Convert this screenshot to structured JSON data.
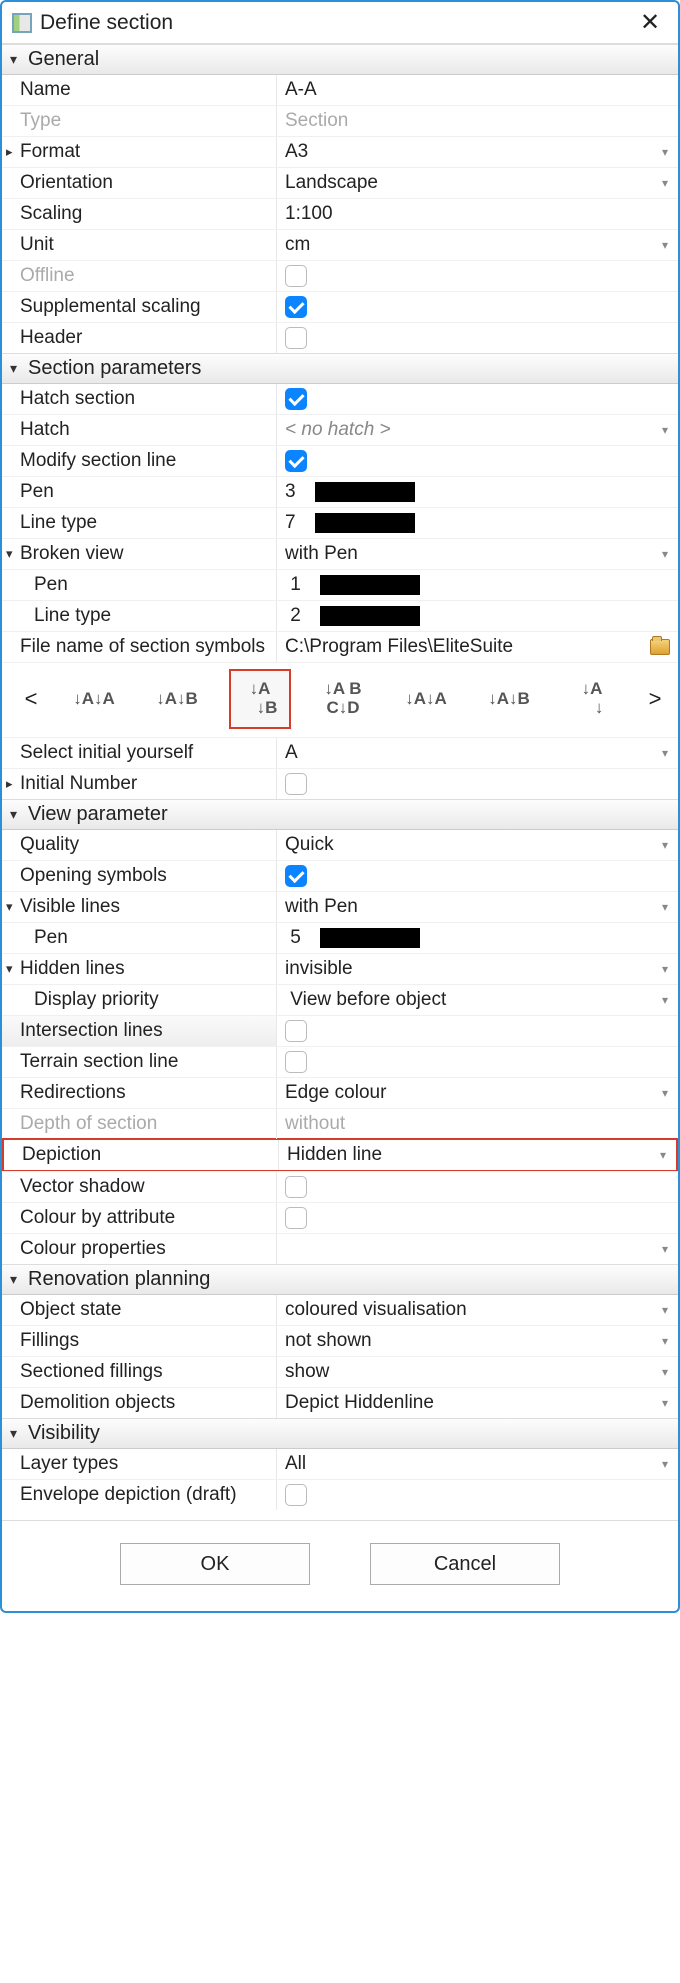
{
  "window_title": "Define section",
  "sections": {
    "general": "General",
    "section_params": "Section parameters",
    "view_param": "View parameter",
    "renovation": "Renovation planning",
    "visibility": "Visibility"
  },
  "general": {
    "name_label": "Name",
    "name_value": "A-A",
    "type_label": "Type",
    "type_value": "Section",
    "format_label": "Format",
    "format_value": "A3",
    "orientation_label": "Orientation",
    "orientation_value": "Landscape",
    "scaling_label": "Scaling",
    "scaling_value": "1:100",
    "unit_label": "Unit",
    "unit_value": "cm",
    "offline_label": "Offline",
    "supp_label": "Supplemental scaling",
    "header_label": "Header"
  },
  "sp": {
    "hatch_section_label": "Hatch section",
    "hatch_label": "Hatch",
    "hatch_value": "< no hatch >",
    "modify_label": "Modify section line",
    "pen_label": "Pen",
    "pen_value": "3",
    "linetype_label": "Line type",
    "linetype_value": "7",
    "broken_label": "Broken view",
    "broken_value": "with Pen",
    "bv_pen_label": "Pen",
    "bv_pen_value": "1",
    "bv_lt_label": "Line type",
    "bv_lt_value": "2",
    "fname_label": "File name of section symbols",
    "fname_value": "C:\\Program Files\\EliteSuite",
    "sym": [
      "↓A↓A",
      "↓A↓B",
      "↓A\n   ↓B",
      "↓A B\nC↓D",
      "↓A↓A",
      "↓A↓B",
      "↓A\n   ↓"
    ],
    "select_initial_label": "Select initial yourself",
    "select_initial_value": "A",
    "initial_num_label": "Initial Number"
  },
  "vp": {
    "quality_label": "Quality",
    "quality_value": "Quick",
    "opening_label": "Opening symbols",
    "vis_lines_label": "Visible lines",
    "vis_lines_value": "with Pen",
    "vl_pen_label": "Pen",
    "vl_pen_value": "5",
    "hidden_label": "Hidden lines",
    "hidden_value": "invisible",
    "disp_prio_label": "Display priority",
    "disp_prio_value": "View before object",
    "inter_label": "Intersection lines",
    "terrain_label": "Terrain section line",
    "redir_label": "Redirections",
    "redir_value": "Edge colour",
    "depth_label": "Depth of section",
    "depth_value": "without",
    "depict_label": "Depiction",
    "depict_value": "Hidden line",
    "vshadow_label": "Vector shadow",
    "cba_label": "Colour by attribute",
    "cprops_label": "Colour properties"
  },
  "rp": {
    "objstate_label": "Object state",
    "objstate_value": "coloured visualisation",
    "fillings_label": "Fillings",
    "fillings_value": "not shown",
    "secfill_label": "Sectioned fillings",
    "secfill_value": "show",
    "demo_label": "Demolition objects",
    "demo_value": "Depict Hiddenline"
  },
  "vis": {
    "layer_label": "Layer types",
    "layer_value": "All",
    "env_label": "Envelope depiction (draft)"
  },
  "buttons": {
    "ok": "OK",
    "cancel": "Cancel"
  }
}
